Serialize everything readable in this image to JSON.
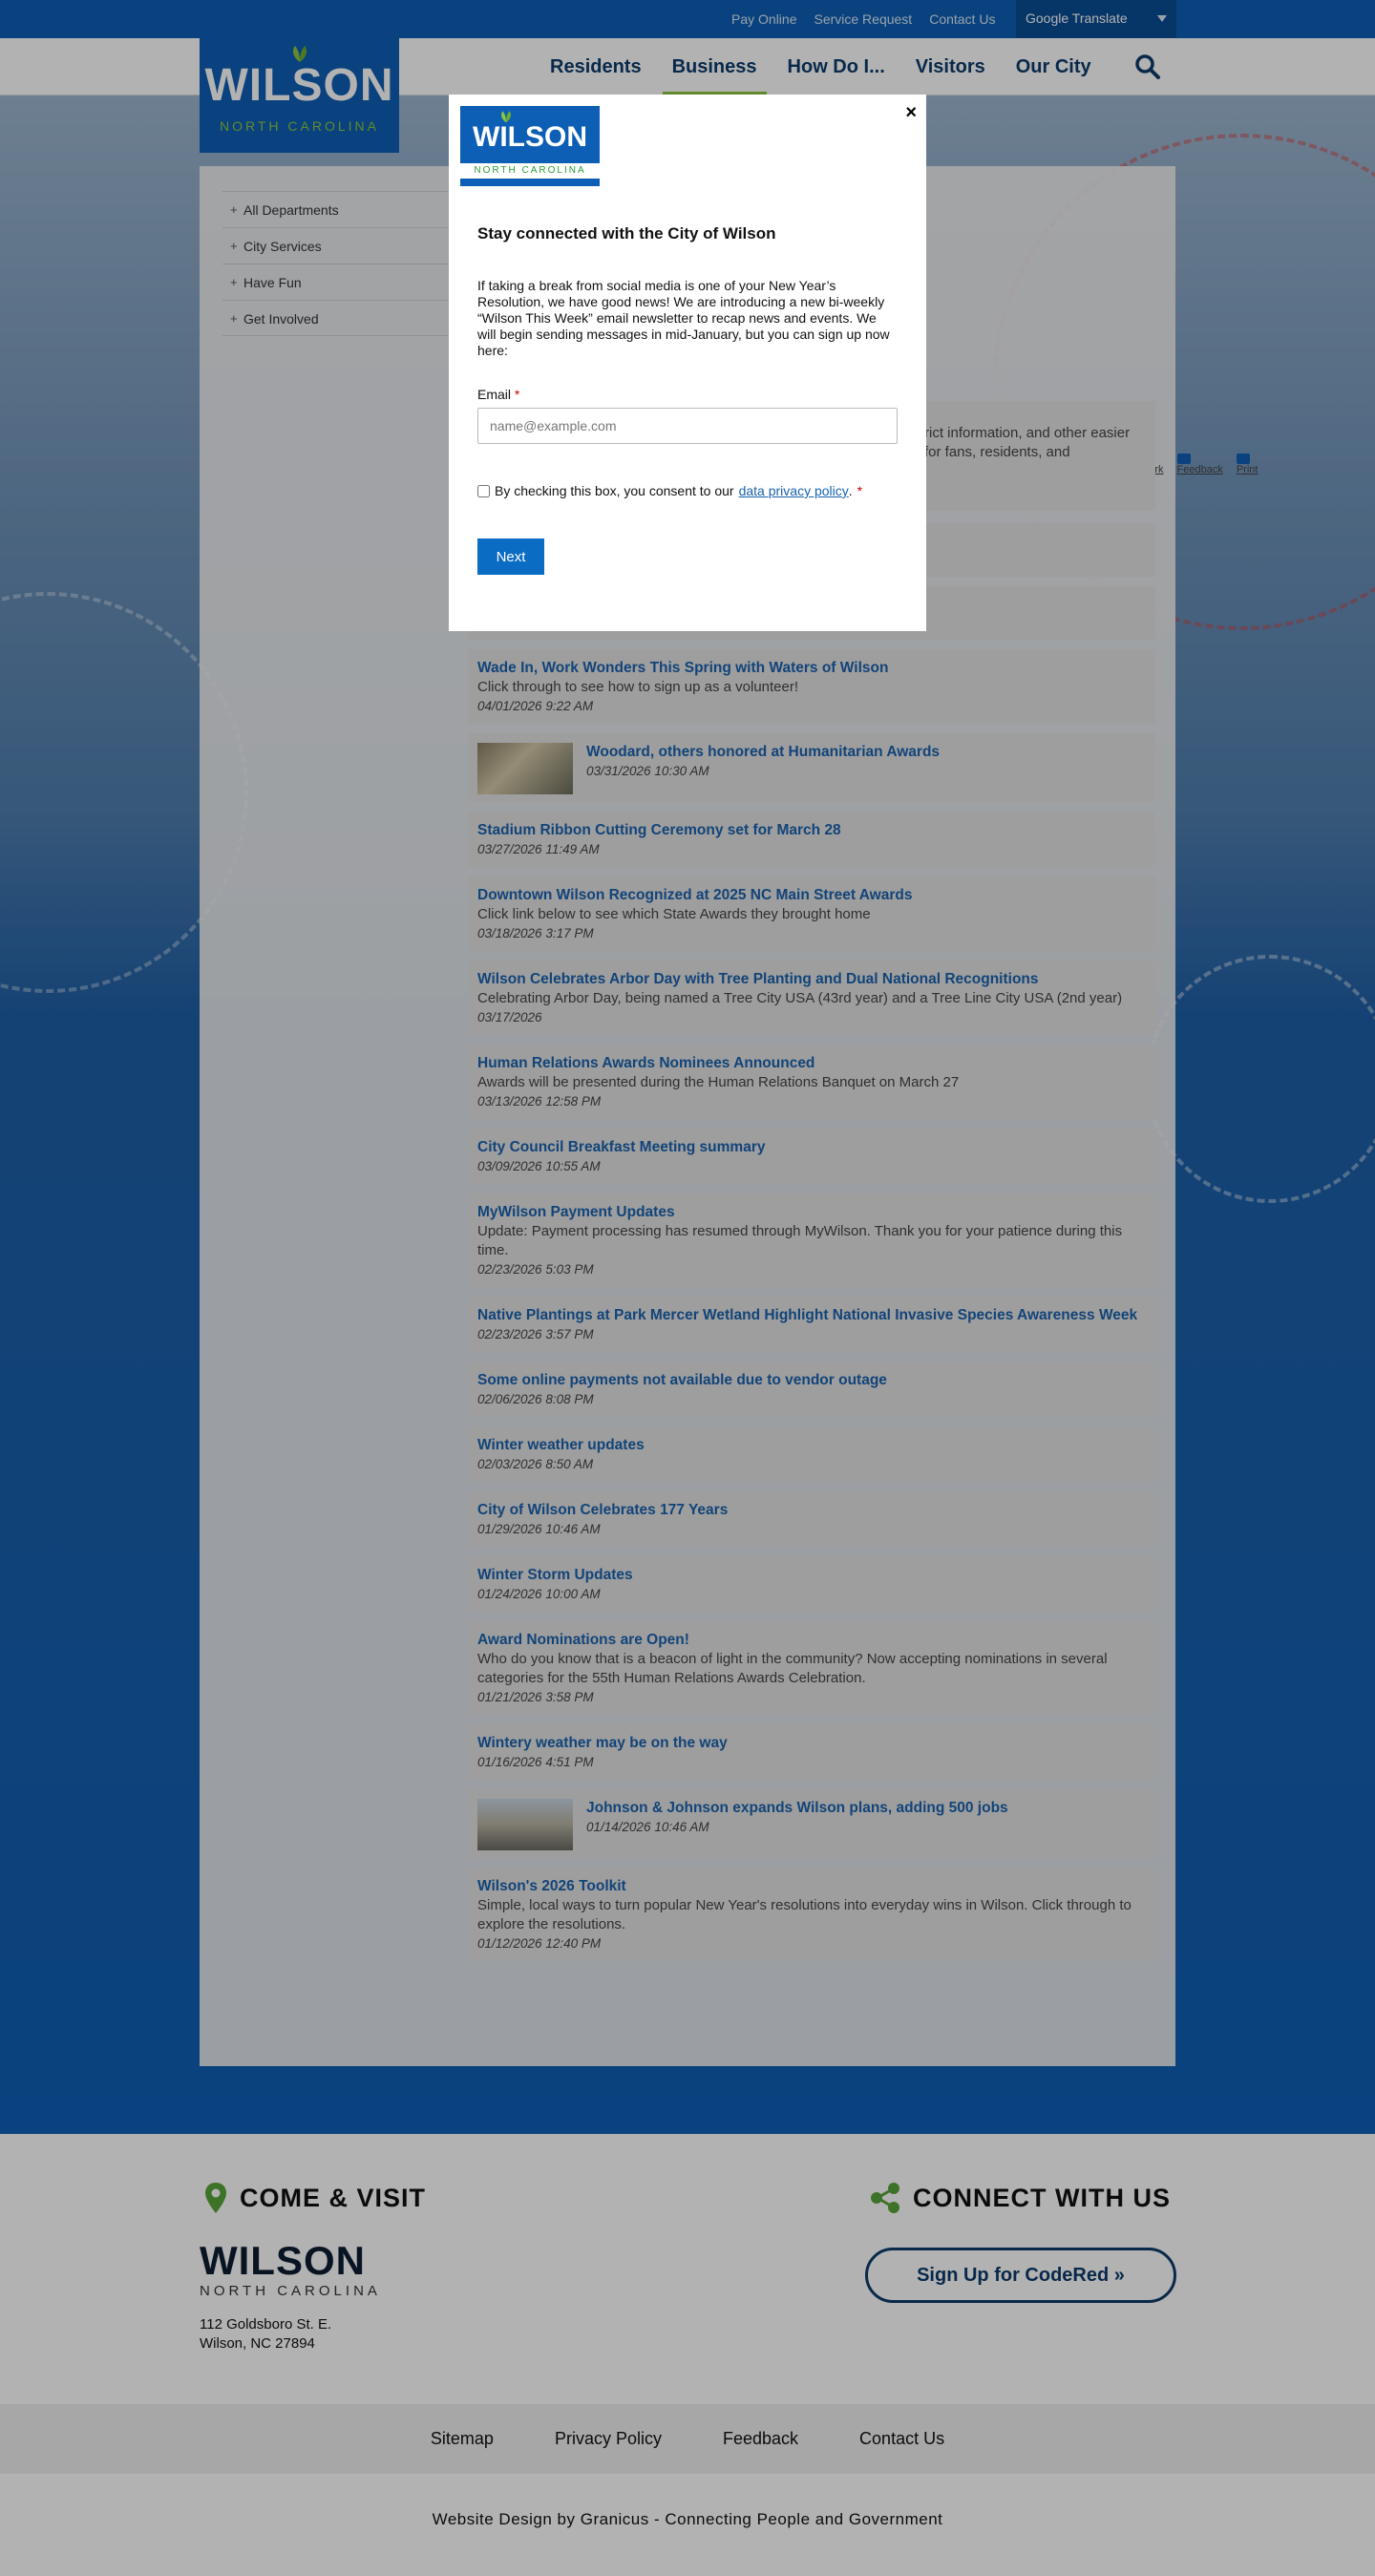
{
  "util_links": [
    "Pay Online",
    "Service Request",
    "Contact Us"
  ],
  "translate_label": "Google Translate",
  "logo": {
    "word": "WILSON",
    "sub": "NORTH CAROLINA"
  },
  "nav": [
    "Residents",
    "Business",
    "How Do I...",
    "Visitors",
    "Our City"
  ],
  "sidebar": [
    "All Departments",
    "City Services",
    "Have Fun",
    "Get Involved"
  ],
  "page_tools": [
    "Share & Bookmark",
    "Feedback",
    "Print"
  ],
  "intro_text": "rict information, and other easier for fans, residents, and",
  "news": [
    {
      "title": "Wade In, Work Wonders This Spring with Waters of Wilson",
      "desc": "Click through to see how to sign up as a volunteer!",
      "date": "04/01/2026 9:22 AM"
    },
    {
      "title": "Woodard, others honored at Humanitarian Awards",
      "desc": "",
      "date": "03/31/2026 10:30 AM",
      "thumb": true
    },
    {
      "title": "Stadium Ribbon Cutting Ceremony set for March 28",
      "desc": "",
      "date": "03/27/2026 11:49 AM"
    },
    {
      "title": "Downtown Wilson Recognized at 2025 NC Main Street Awards",
      "desc": "Click link below to see which State Awards they brought home",
      "date": "03/18/2026 3:17 PM"
    },
    {
      "title": "Wilson Celebrates Arbor Day with Tree Planting and Dual National Recognitions",
      "desc": "Celebrating Arbor Day, being named a Tree City USA (43rd year) and a Tree Line City USA (2nd year)",
      "date": "03/17/2026"
    },
    {
      "title": "Human Relations Awards Nominees Announced",
      "desc": "Awards will be presented during the Human Relations Banquet on March 27",
      "date": "03/13/2026 12:58 PM"
    },
    {
      "title": "City Council Breakfast Meeting summary",
      "desc": "",
      "date": "03/09/2026 10:55 AM"
    },
    {
      "title": "MyWilson Payment Updates",
      "desc": "Update: Payment processing has resumed through MyWilson. Thank you for your patience during this time.",
      "date": "02/23/2026 5:03 PM"
    },
    {
      "title": "Native Plantings at Park Mercer Wetland Highlight National Invasive Species Awareness Week",
      "desc": "",
      "date": "02/23/2026 3:57 PM"
    },
    {
      "title": "Some online payments not available due to vendor outage",
      "desc": "",
      "date": "02/06/2026 8:08 PM"
    },
    {
      "title": "Winter weather updates",
      "desc": "",
      "date": "02/03/2026 8:50 AM"
    },
    {
      "title": "City of Wilson Celebrates 177 Years",
      "desc": "",
      "date": "01/29/2026 10:46 AM"
    },
    {
      "title": "Winter Storm Updates",
      "desc": "",
      "date": "01/24/2026 10:00 AM"
    },
    {
      "title": "Award Nominations are Open!",
      "desc": "Who do you know that is a beacon of light in the community? Now accepting nominations in several categories for the 55th Human Relations Awards Celebration.",
      "date": "01/21/2026 3:58 PM"
    },
    {
      "title": "Wintery weather may be on the way",
      "desc": "",
      "date": "01/16/2026 4:51 PM"
    },
    {
      "title": "Johnson & Johnson expands Wilson plans, adding 500 jobs",
      "desc": "",
      "date": "01/14/2026 10:46 AM",
      "thumb": true
    },
    {
      "title": "Wilson's 2026 Toolkit",
      "desc": "Simple, local ways to turn popular New Year's resolutions into everyday wins in Wilson. Click through to explore the resolutions.",
      "date": "01/12/2026 12:40 PM"
    }
  ],
  "modal": {
    "close": "×",
    "logo_word": "WILSON",
    "logo_sub": "NORTH CAROLINA",
    "title": "Stay connected with the City of Wilson",
    "body": "If taking a break from social media is one of your New Year’s Resolution, we have good news! We are introducing a new bi-weekly “Wilson This Week” email newsletter to recap news and events. We will begin sending messages in mid-January, but you can sign up now here:",
    "email_label": "Email",
    "required_mark": "*",
    "email_placeholder": "name@example.com",
    "consent_prefix": "By checking this box, you consent to our",
    "consent_link": "data privacy policy",
    "consent_suffix": ".",
    "next_label": "Next"
  },
  "footer": {
    "visit_heading": "COME & VISIT",
    "connect_heading": "CONNECT WITH US",
    "logo_word": "WILSON",
    "logo_sub": "NORTH CAROLINA",
    "address_line1": "112 Goldsboro St. E.",
    "address_line2": "Wilson, NC 27894",
    "codered_label": "Sign Up for CodeRed »",
    "links": [
      "Sitemap",
      "Privacy Policy",
      "Feedback",
      "Contact Us"
    ],
    "credit": "Website Design by Granicus - Connecting People and Government"
  },
  "colors": {
    "brand_blue": "#0d5fb5",
    "accent_green": "#8dc63f",
    "link_blue": "#1a62ae",
    "button_blue": "#0a6cc2"
  }
}
